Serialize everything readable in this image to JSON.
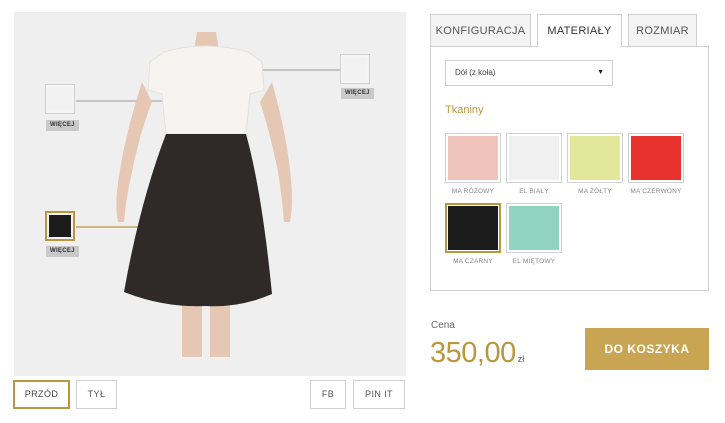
{
  "preview": {
    "callouts": [
      {
        "more_label": "WIĘCEJ",
        "swatch_color": "#f2f2f2"
      },
      {
        "more_label": "WIĘCEJ",
        "swatch_color": "#f2f2f2"
      },
      {
        "more_label": "WIĘCEJ",
        "swatch_color": "#1c1c1c"
      }
    ],
    "colors": {
      "top": "#f6f4f1",
      "skirt": "#2f2a27",
      "skin": "#e6c7b4",
      "line_gray": "#9a9a9a",
      "line_gold": "#b8973f"
    }
  },
  "view_buttons": {
    "front": "PRZÓD",
    "back": "TYŁ",
    "fb": "FB",
    "pinit": "PIN IT"
  },
  "tabs": [
    {
      "label": "KONFIGURACJA",
      "active": false
    },
    {
      "label": "MATERIAŁY",
      "active": true
    },
    {
      "label": "ROZMIAR",
      "active": false
    }
  ],
  "panel": {
    "select_value": "Dół (z koła)",
    "select_arrow": "▼",
    "section_title": "Tkaniny",
    "fabrics": [
      {
        "name": "MA RÓŻOWY",
        "color": "#edc3bc",
        "selected": false
      },
      {
        "name": "EL BIAŁY",
        "color": "#f0f0f0",
        "selected": false
      },
      {
        "name": "MA ŻÓŁTY",
        "color": "#e3e79a",
        "selected": false
      },
      {
        "name": "MA CZERWONY",
        "color": "#e8322d",
        "selected": false
      },
      {
        "name": "MA CZARNY",
        "color": "#1c1c1c",
        "selected": true
      },
      {
        "name": "EL MIĘTOWY",
        "color": "#8fd3c0",
        "selected": false
      }
    ]
  },
  "price": {
    "label": "Cena",
    "value": "350,00",
    "currency": "zł"
  },
  "cart_button": "DO KOSZYKA",
  "accent_color": "#b8973f"
}
